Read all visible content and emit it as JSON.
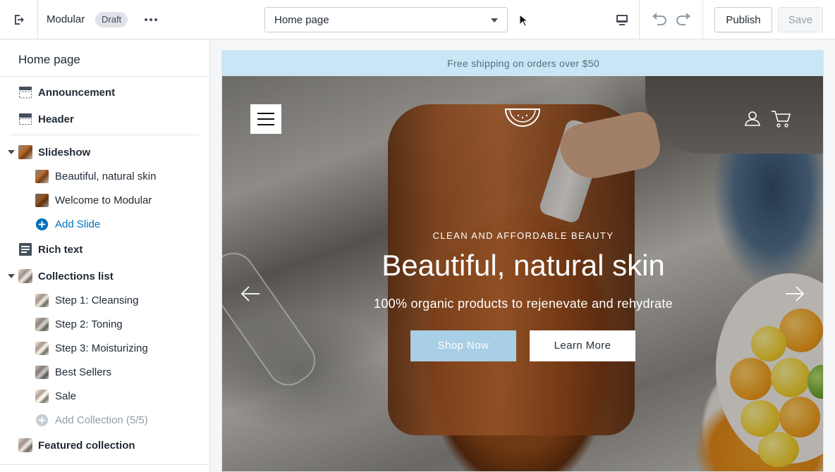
{
  "topbar": {
    "theme_name": "Modular",
    "status_badge": "Draft",
    "page_select": "Home page",
    "publish_label": "Publish",
    "save_label": "Save"
  },
  "sidebar": {
    "title": "Home page",
    "sections": [
      {
        "label": "Announcement",
        "icon": "announcement-bar-icon"
      },
      {
        "label": "Header",
        "icon": "header-layout-icon"
      },
      {
        "label": "Slideshow",
        "icon": "slideshow-thumbnail",
        "expanded": true,
        "children": [
          {
            "label": "Beautiful, natural skin"
          },
          {
            "label": "Welcome to Modular"
          },
          {
            "label": "Add Slide",
            "type": "add"
          }
        ]
      },
      {
        "label": "Rich text",
        "icon": "text-block-icon"
      },
      {
        "label": "Collections list",
        "icon": "collections-thumbnail",
        "expanded": true,
        "children": [
          {
            "label": "Step 1: Cleansing"
          },
          {
            "label": "Step 2: Toning"
          },
          {
            "label": "Step 3: Moisturizing"
          },
          {
            "label": "Best Sellers"
          },
          {
            "label": "Sale"
          },
          {
            "label": "Add Collection (5/5)",
            "type": "add-disabled"
          }
        ]
      },
      {
        "label": "Featured collection",
        "icon": "collection-thumbnail"
      }
    ]
  },
  "preview": {
    "announcement": "Free shipping on orders over $50",
    "slide": {
      "kicker": "CLEAN AND AFFORDABLE BEAUTY",
      "heading": "Beautiful, natural skin",
      "subheading": "100% organic products to rejenevate and rehydrate",
      "primary_button": "Shop Now",
      "secondary_button": "Learn More"
    }
  },
  "colors": {
    "announcement_bg": "#c8e6f5",
    "shop_button_bg": "#a9cfe6",
    "link_blue": "#006fbb"
  }
}
